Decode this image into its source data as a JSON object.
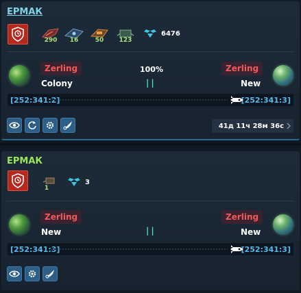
{
  "fleets": [
    {
      "name": "ЕРМАК",
      "ships": [
        {
          "icon": "ship-cruiser-icon",
          "count": "290"
        },
        {
          "icon": "ship-bomber-icon",
          "count": "16"
        },
        {
          "icon": "ship-destroyer-icon",
          "count": "50"
        },
        {
          "icon": "ship-transport-icon",
          "count": "123"
        }
      ],
      "speed": "6476",
      "progress": "100%",
      "origin": {
        "player": "Zerling",
        "type": "Colony",
        "coords": "[252:341:2]"
      },
      "target": {
        "player": "Zerling",
        "type": "New",
        "coords": "[252:341:3]"
      },
      "timer": "41д 11ч 28м 36с"
    },
    {
      "name": "ЕРМАК",
      "ships": [
        {
          "icon": "ship-small-icon",
          "count": "1"
        }
      ],
      "speed": "3",
      "origin": {
        "player": "Zerling",
        "type": "New",
        "coords": "[252:341:3]"
      },
      "target": {
        "player": "Zerling",
        "type": "New",
        "coords": "[252:341:3]"
      }
    }
  ],
  "colors": {
    "accent": "#2d5e86",
    "mission": "#b7281f",
    "player": "#f05a5a",
    "coords": "#5ab7e8",
    "fleet1_name": "#7fd3e6",
    "fleet2_name": "#9be65a"
  }
}
